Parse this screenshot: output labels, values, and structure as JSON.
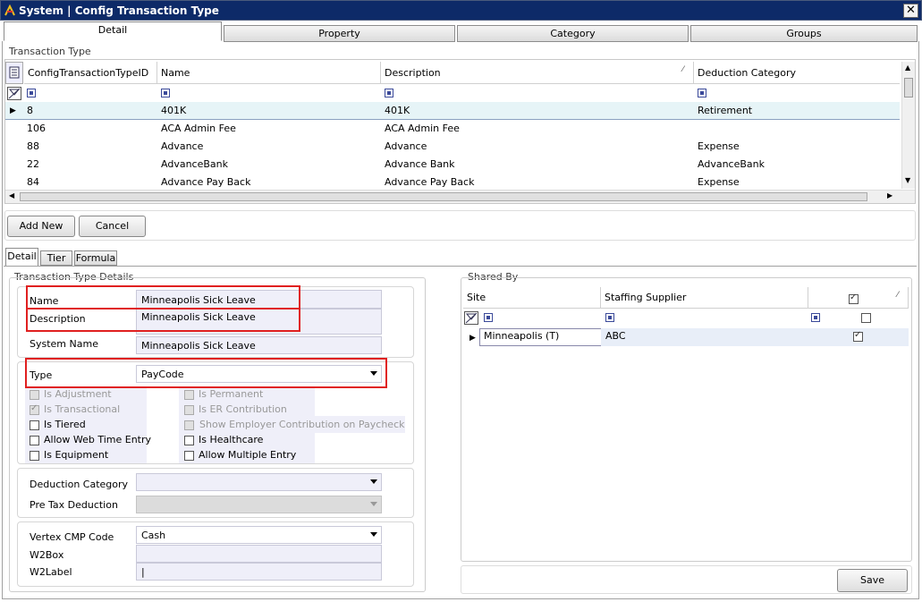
{
  "window": {
    "title": "System | Config Transaction Type",
    "close_glyph": "✕"
  },
  "top_tabs": [
    "Detail",
    "Property",
    "Category",
    "Groups"
  ],
  "grid": {
    "group_label": "Transaction Type",
    "columns": [
      "ConfigTransactionTypeID",
      "Name",
      "Description",
      "Deduction Category"
    ],
    "rows": [
      [
        "8",
        "401K",
        "401K",
        "Retirement"
      ],
      [
        "106",
        "ACA Admin Fee",
        "ACA Admin Fee",
        ""
      ],
      [
        "88",
        "Advance",
        "Advance",
        "Expense"
      ],
      [
        "22",
        "AdvanceBank",
        "Advance Bank",
        "AdvanceBank"
      ],
      [
        "84",
        "Advance Pay Back",
        "Advance Pay Back",
        "Expense"
      ]
    ],
    "selected_row": 0
  },
  "actions": {
    "add_new": "Add New",
    "cancel": "Cancel"
  },
  "detail_tabs": [
    "Detail",
    "Tier",
    "Formula"
  ],
  "details": {
    "group_label": "Transaction Type Details",
    "name_label": "Name",
    "name_value": "Minneapolis Sick Leave",
    "description_label": "Description",
    "description_value": "Minneapolis Sick Leave",
    "system_name_label": "System Name",
    "system_name_value": "Minneapolis Sick Leave",
    "type_label": "Type",
    "type_value": "PayCode",
    "checks": {
      "is_adjustment": {
        "label": "Is Adjustment",
        "checked": false,
        "enabled": false
      },
      "is_permanent": {
        "label": "Is Permanent",
        "checked": false,
        "enabled": false
      },
      "is_transactional": {
        "label": "Is Transactional",
        "checked": true,
        "enabled": false
      },
      "is_er_contribution": {
        "label": "Is ER Contribution",
        "checked": false,
        "enabled": false
      },
      "is_tiered": {
        "label": "Is Tiered",
        "checked": false,
        "enabled": true
      },
      "show_employer": {
        "label": "Show Employer Contribution on Paycheck",
        "checked": false,
        "enabled": false
      },
      "allow_web_time": {
        "label": "Allow Web Time Entry",
        "checked": false,
        "enabled": true
      },
      "is_healthcare": {
        "label": "Is Healthcare",
        "checked": false,
        "enabled": true
      },
      "is_equipment": {
        "label": "Is Equipment",
        "checked": false,
        "enabled": true
      },
      "allow_multiple": {
        "label": "Allow Multiple Entry",
        "checked": false,
        "enabled": true
      }
    },
    "deduction_category_label": "Deduction Category",
    "deduction_category_value": "",
    "pre_tax_label": "Pre Tax Deduction",
    "pre_tax_value": "",
    "vertex_label": "Vertex CMP Code",
    "vertex_value": "Cash",
    "w2box_label": "W2Box",
    "w2box_value": "",
    "w2label_label": "W2Label",
    "w2label_value": "|"
  },
  "shared": {
    "group_label": "Shared By",
    "columns": [
      "Site",
      "Staffing Supplier"
    ],
    "rows": [
      {
        "site": "Minneapolis (T)",
        "supplier": "ABC",
        "checked": true
      }
    ],
    "header_checked": true
  },
  "save_label": "Save"
}
